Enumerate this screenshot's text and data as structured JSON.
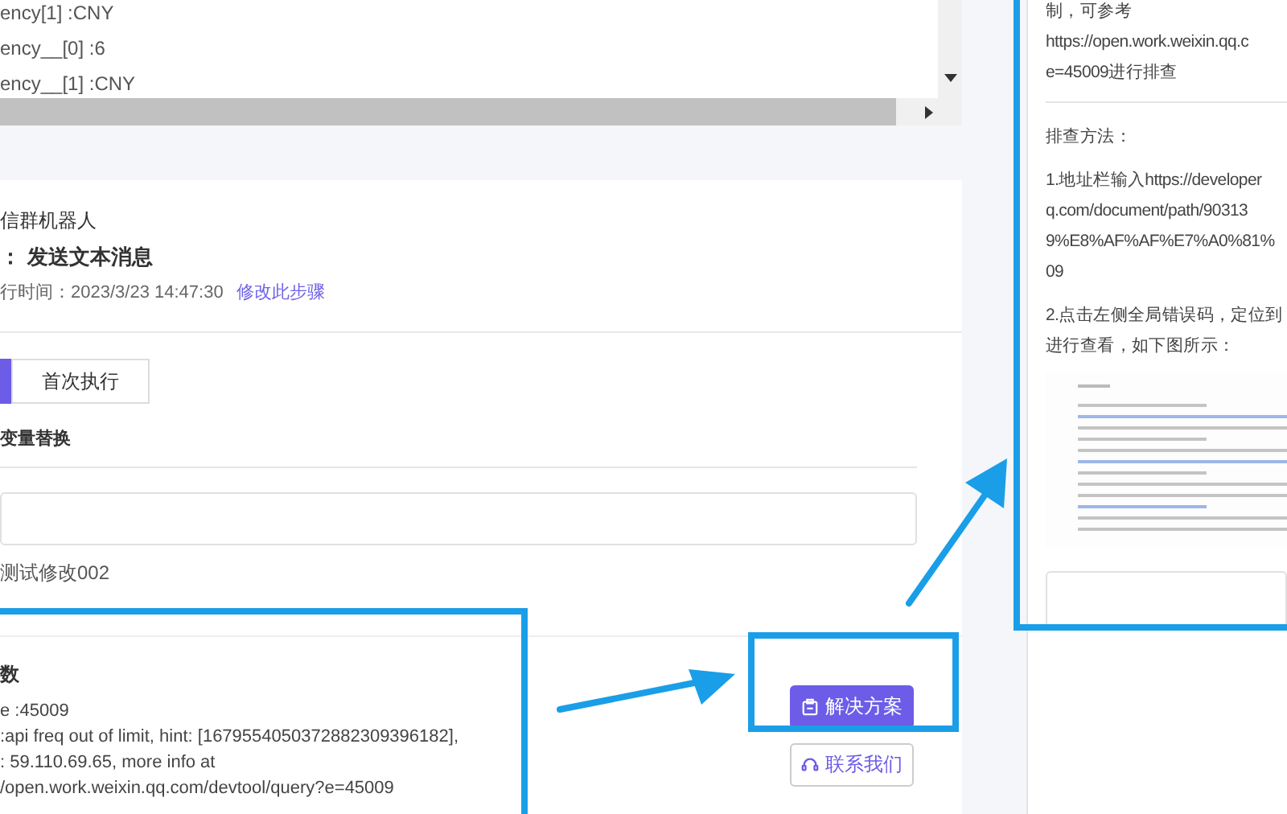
{
  "code_panel": {
    "lines": [
      "ency[1] :CNY",
      "ency__[0] :6",
      "ency__[1] :CNY"
    ]
  },
  "step": {
    "app": "信群机器人",
    "action_label": "：",
    "action": "发送文本消息",
    "time_label": "行时间：",
    "time": "2023/3/23 14:47:30",
    "edit_link": "修改此步骤"
  },
  "run_tabs": [
    {
      "selected": true
    },
    {
      "label": "首次执行",
      "selected": false
    }
  ],
  "variables": {
    "title": "变量替换",
    "value_line": "测试修改002"
  },
  "error": {
    "title": "数",
    "lines": [
      "e :45009",
      ":api freq out of limit, hint: [1679554050372882309396182],",
      ": 59.110.69.65, more info at",
      "/open.work.weixin.qq.com/devtool/query?e=45009"
    ]
  },
  "actions": [
    {
      "label": "解决方案",
      "kind": "primary"
    },
    {
      "label": "联系我们",
      "kind": "outline"
    }
  ],
  "solution_panel": {
    "intro": [
      "制，可参考",
      "https://open.work.weixin.qq.c",
      "e=45009进行排查"
    ],
    "method_title": "排查方法：",
    "steps": [
      [
        "1.地址栏输入https://developer",
        "q.com/document/path/90313",
        "9%E8%AF%AF%E7%A0%81%",
        "09"
      ],
      [
        "2.点击左侧全局错误码，定位到",
        "进行查看，如下图所示："
      ]
    ]
  }
}
